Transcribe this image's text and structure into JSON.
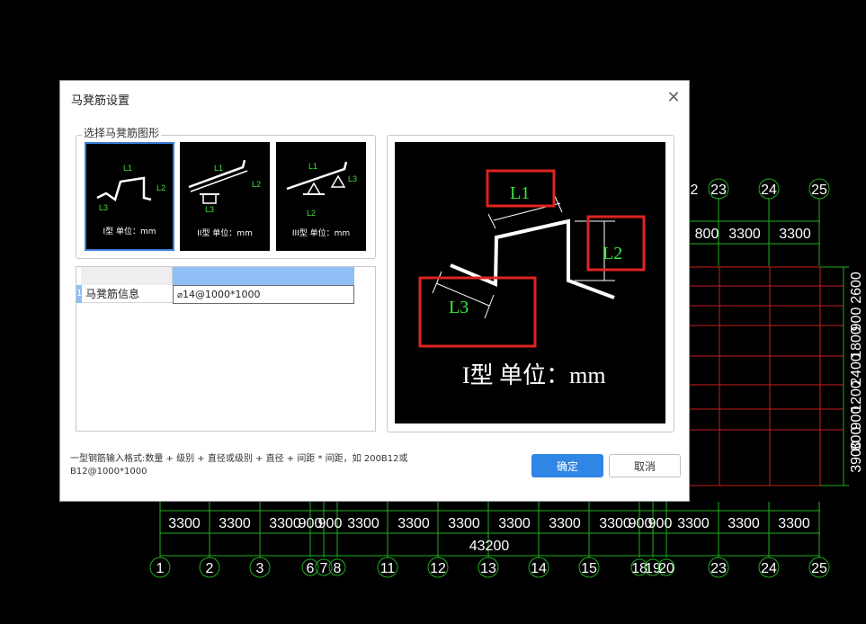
{
  "dialog": {
    "title": "马凳筋设置",
    "close_glyph": "✕",
    "group_legend": "选择马凳筋图形",
    "shapes": [
      {
        "caption": "I型 单位：mm",
        "selected": true
      },
      {
        "caption": "II型 单位：mm",
        "selected": false
      },
      {
        "caption": "III型 单位：mm",
        "selected": false
      }
    ],
    "table": {
      "row_number": "1",
      "label": "马凳筋信息",
      "rebar_symbol": "⌀",
      "value": "14@1000*1000"
    },
    "preview": {
      "labels": {
        "l1": "L1",
        "l2": "L2",
        "l3": "L3"
      },
      "caption": "I型 单位：mm"
    },
    "hint": "一型钢筋输入格式:数量 + 级别 + 直径或级别 + 直径 + 间距 * 间距，如 200B12或 B12@1000*1000",
    "ok_label": "确定",
    "cancel_label": "取消"
  },
  "cad": {
    "top_axis_numbers": [
      "2",
      "23",
      "24",
      "25"
    ],
    "top_dims": [
      "800",
      "3300",
      "3300"
    ],
    "bottom_dims": [
      "3300",
      "3300",
      "3300",
      "900",
      "900",
      "3300",
      "3300",
      "3300",
      "3300",
      "3300",
      "3300",
      "900",
      "900",
      "3300",
      "3300",
      "3300"
    ],
    "total_dim": "43200",
    "bottom_axis_numbers": [
      "1",
      "2",
      "3",
      "6",
      "7",
      "8",
      "11",
      "12",
      "13",
      "14",
      "15",
      "18",
      "19",
      "20",
      "23",
      "24",
      "25"
    ],
    "right_dims": [
      "2600",
      "900",
      "1800",
      "2400",
      "1200",
      "900",
      "800",
      "3900"
    ]
  },
  "colors": {
    "cad_background": "#000000",
    "axis_green": "#1fae1f",
    "beam_red": "#c81e1e",
    "accent_blue": "#2f86e6",
    "highlight_red": "#e0241f",
    "label_green": "#38e838"
  }
}
